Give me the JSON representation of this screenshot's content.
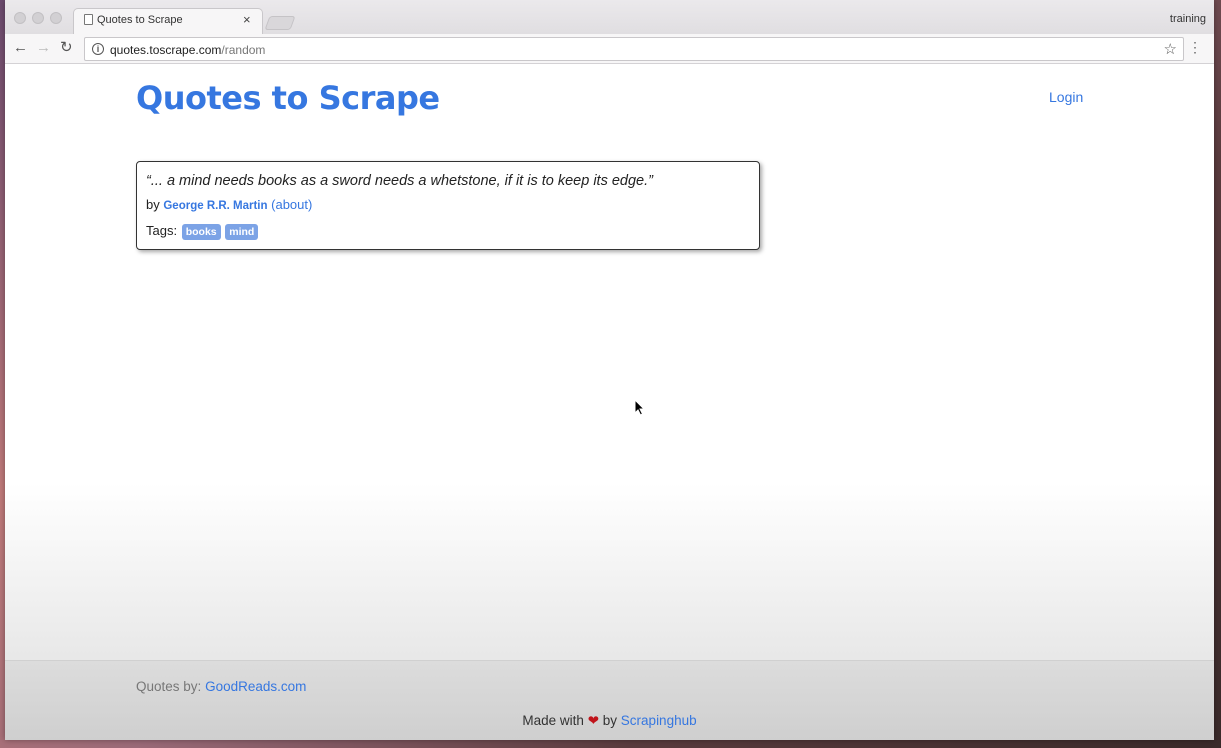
{
  "browser": {
    "tab_title": "Quotes to Scrape",
    "tab_close": "×",
    "profile_name": "training",
    "url_host": "quotes.toscrape.com",
    "url_path": "/random"
  },
  "header": {
    "site_title": "Quotes to Scrape",
    "login_label": "Login"
  },
  "quote": {
    "text": "“... a mind needs books as a sword needs a whetstone, if it is to keep its edge.”",
    "by_label": "by",
    "author": "George R.R. Martin",
    "about_label": "(about)",
    "tags_label": "Tags:",
    "tags": [
      "books",
      "mind"
    ]
  },
  "footer": {
    "quotes_by_label": "Quotes by:",
    "quotes_by_link": "GoodReads.com",
    "made_with_label": "Made with",
    "heart": "❤",
    "by_label": "by",
    "made_by_link": "Scrapinghub"
  },
  "colors": {
    "accent": "#3677e0",
    "tag_bg": "#7ca3e6",
    "heart": "#c0141b"
  }
}
